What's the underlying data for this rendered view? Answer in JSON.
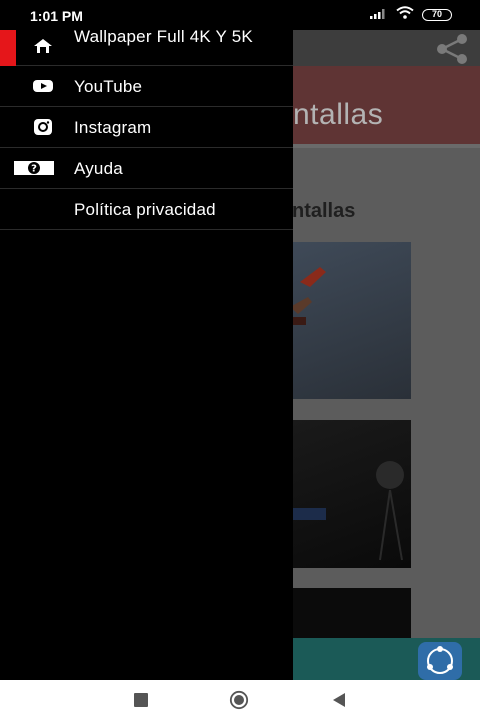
{
  "status_bar": {
    "time": "1:01 PM",
    "battery": "70",
    "signal_icon": "signal-icon",
    "wifi_icon": "wifi-icon"
  },
  "background_app": {
    "banner_text": "ntallas",
    "section_title": "ntallas",
    "share_icon": "share-icon"
  },
  "drawer": {
    "items": [
      {
        "label": "Wallpaper Full 4K Y 5K",
        "icon": "home-icon",
        "active": true
      },
      {
        "label": "YouTube",
        "icon": "youtube-icon",
        "active": false
      },
      {
        "label": "Instagram",
        "icon": "instagram-icon",
        "active": false
      },
      {
        "label": "Ayuda",
        "icon": "help-icon",
        "active": false
      },
      {
        "label": "Política privacidad",
        "icon": "",
        "active": false
      }
    ],
    "active_color": "#e5161a"
  },
  "nav_bar": {
    "recents_icon": "recents-icon",
    "home_icon": "home-circle-icon",
    "back_icon": "back-icon"
  }
}
